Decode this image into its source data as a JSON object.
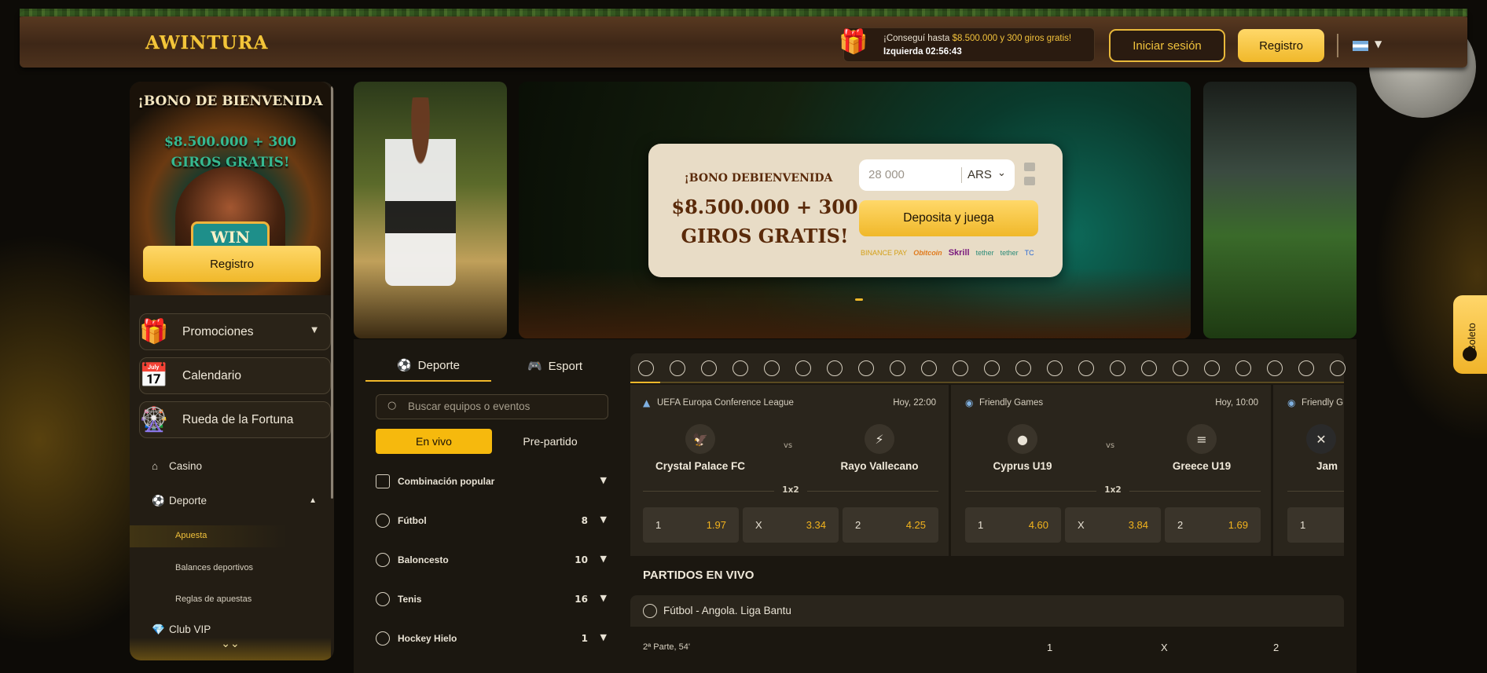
{
  "header": {
    "logo": "AWINTURA",
    "promo_line1_prefix": "¡Conseguí hasta ",
    "promo_line1_highlight": "$8.500.000 y 300 giros gratis!",
    "promo_line2": "Izquierda 02:56:43",
    "login_label": "Iniciar sesión",
    "register_label": "Registro",
    "language_flag": "argentina-flag-icon"
  },
  "sidebar": {
    "banner_title": "¡BONO DE BIENVENIDA",
    "banner_amount": "$8.500.000 + 300 GIROS GRATIS!",
    "banner_slot": "WIN",
    "register_label": "Registro",
    "cards": [
      {
        "label": "Promociones",
        "icon": "gift-icon"
      },
      {
        "label": "Calendario",
        "icon": "calendar-icon"
      },
      {
        "label": "Rueda de la Fortuna",
        "icon": "wheel-icon"
      }
    ],
    "items": [
      {
        "label": "Casino",
        "icon": "home-icon"
      },
      {
        "label": "Deporte",
        "icon": "ball-icon"
      },
      {
        "label": "Club VIP",
        "icon": "diamond-icon"
      }
    ],
    "sub_items": [
      "Apuesta",
      "Balances deportivos",
      "Reglas de apuestas"
    ]
  },
  "banner": {
    "title": "¡BONO DEBIENVENIDA",
    "amount": "$8.500.000 + 300 GIROS GRATIS!",
    "amount_placeholder": "28 000",
    "currency": "ARS",
    "deposit_label": "Deposita y juega",
    "payments": [
      "BINANCE PAY",
      "Obitcoin",
      "Skrill",
      "tether",
      "tether",
      "TC"
    ]
  },
  "sports": {
    "tab_sport": "Deporte",
    "tab_esport": "Esport",
    "search_placeholder": "Buscar equipos o eventos",
    "live_label": "En vivo",
    "prematch_label": "Pre-partido",
    "list": [
      {
        "label": "Combinación popular",
        "count": ""
      },
      {
        "label": "Fútbol",
        "count": "8"
      },
      {
        "label": "Baloncesto",
        "count": "10"
      },
      {
        "label": "Tenis",
        "count": "16"
      },
      {
        "label": "Hockey Hielo",
        "count": "1"
      }
    ]
  },
  "matches": [
    {
      "league": "UEFA Europa Conference League",
      "time": "Hoy, 22:00",
      "home": "Crystal Palace FC",
      "away": "Rayo Vallecano",
      "market": "1x2",
      "odds": [
        {
          "k": "1",
          "v": "1.97"
        },
        {
          "k": "X",
          "v": "3.34"
        },
        {
          "k": "2",
          "v": "4.25"
        }
      ]
    },
    {
      "league": "Friendly Games",
      "time": "Hoy, 10:00",
      "home": "Cyprus U19",
      "away": "Greece U19",
      "market": "1x2",
      "odds": [
        {
          "k": "1",
          "v": "4.60"
        },
        {
          "k": "X",
          "v": "3.84"
        },
        {
          "k": "2",
          "v": "1.69"
        }
      ]
    },
    {
      "league": "Friendly G",
      "time": "",
      "home": "Jam",
      "away": "",
      "market": "",
      "odds": [
        {
          "k": "1",
          "v": ""
        }
      ]
    }
  ],
  "live": {
    "title": "PARTIDOS EN VIVO",
    "group": "Fútbol  -  Angola. Liga Bantu",
    "period": "2ª Parte, 54'",
    "col1": "1",
    "colx": "X",
    "col2": "2"
  },
  "betslip": {
    "label": "Boleto"
  },
  "vs_label": "vs"
}
